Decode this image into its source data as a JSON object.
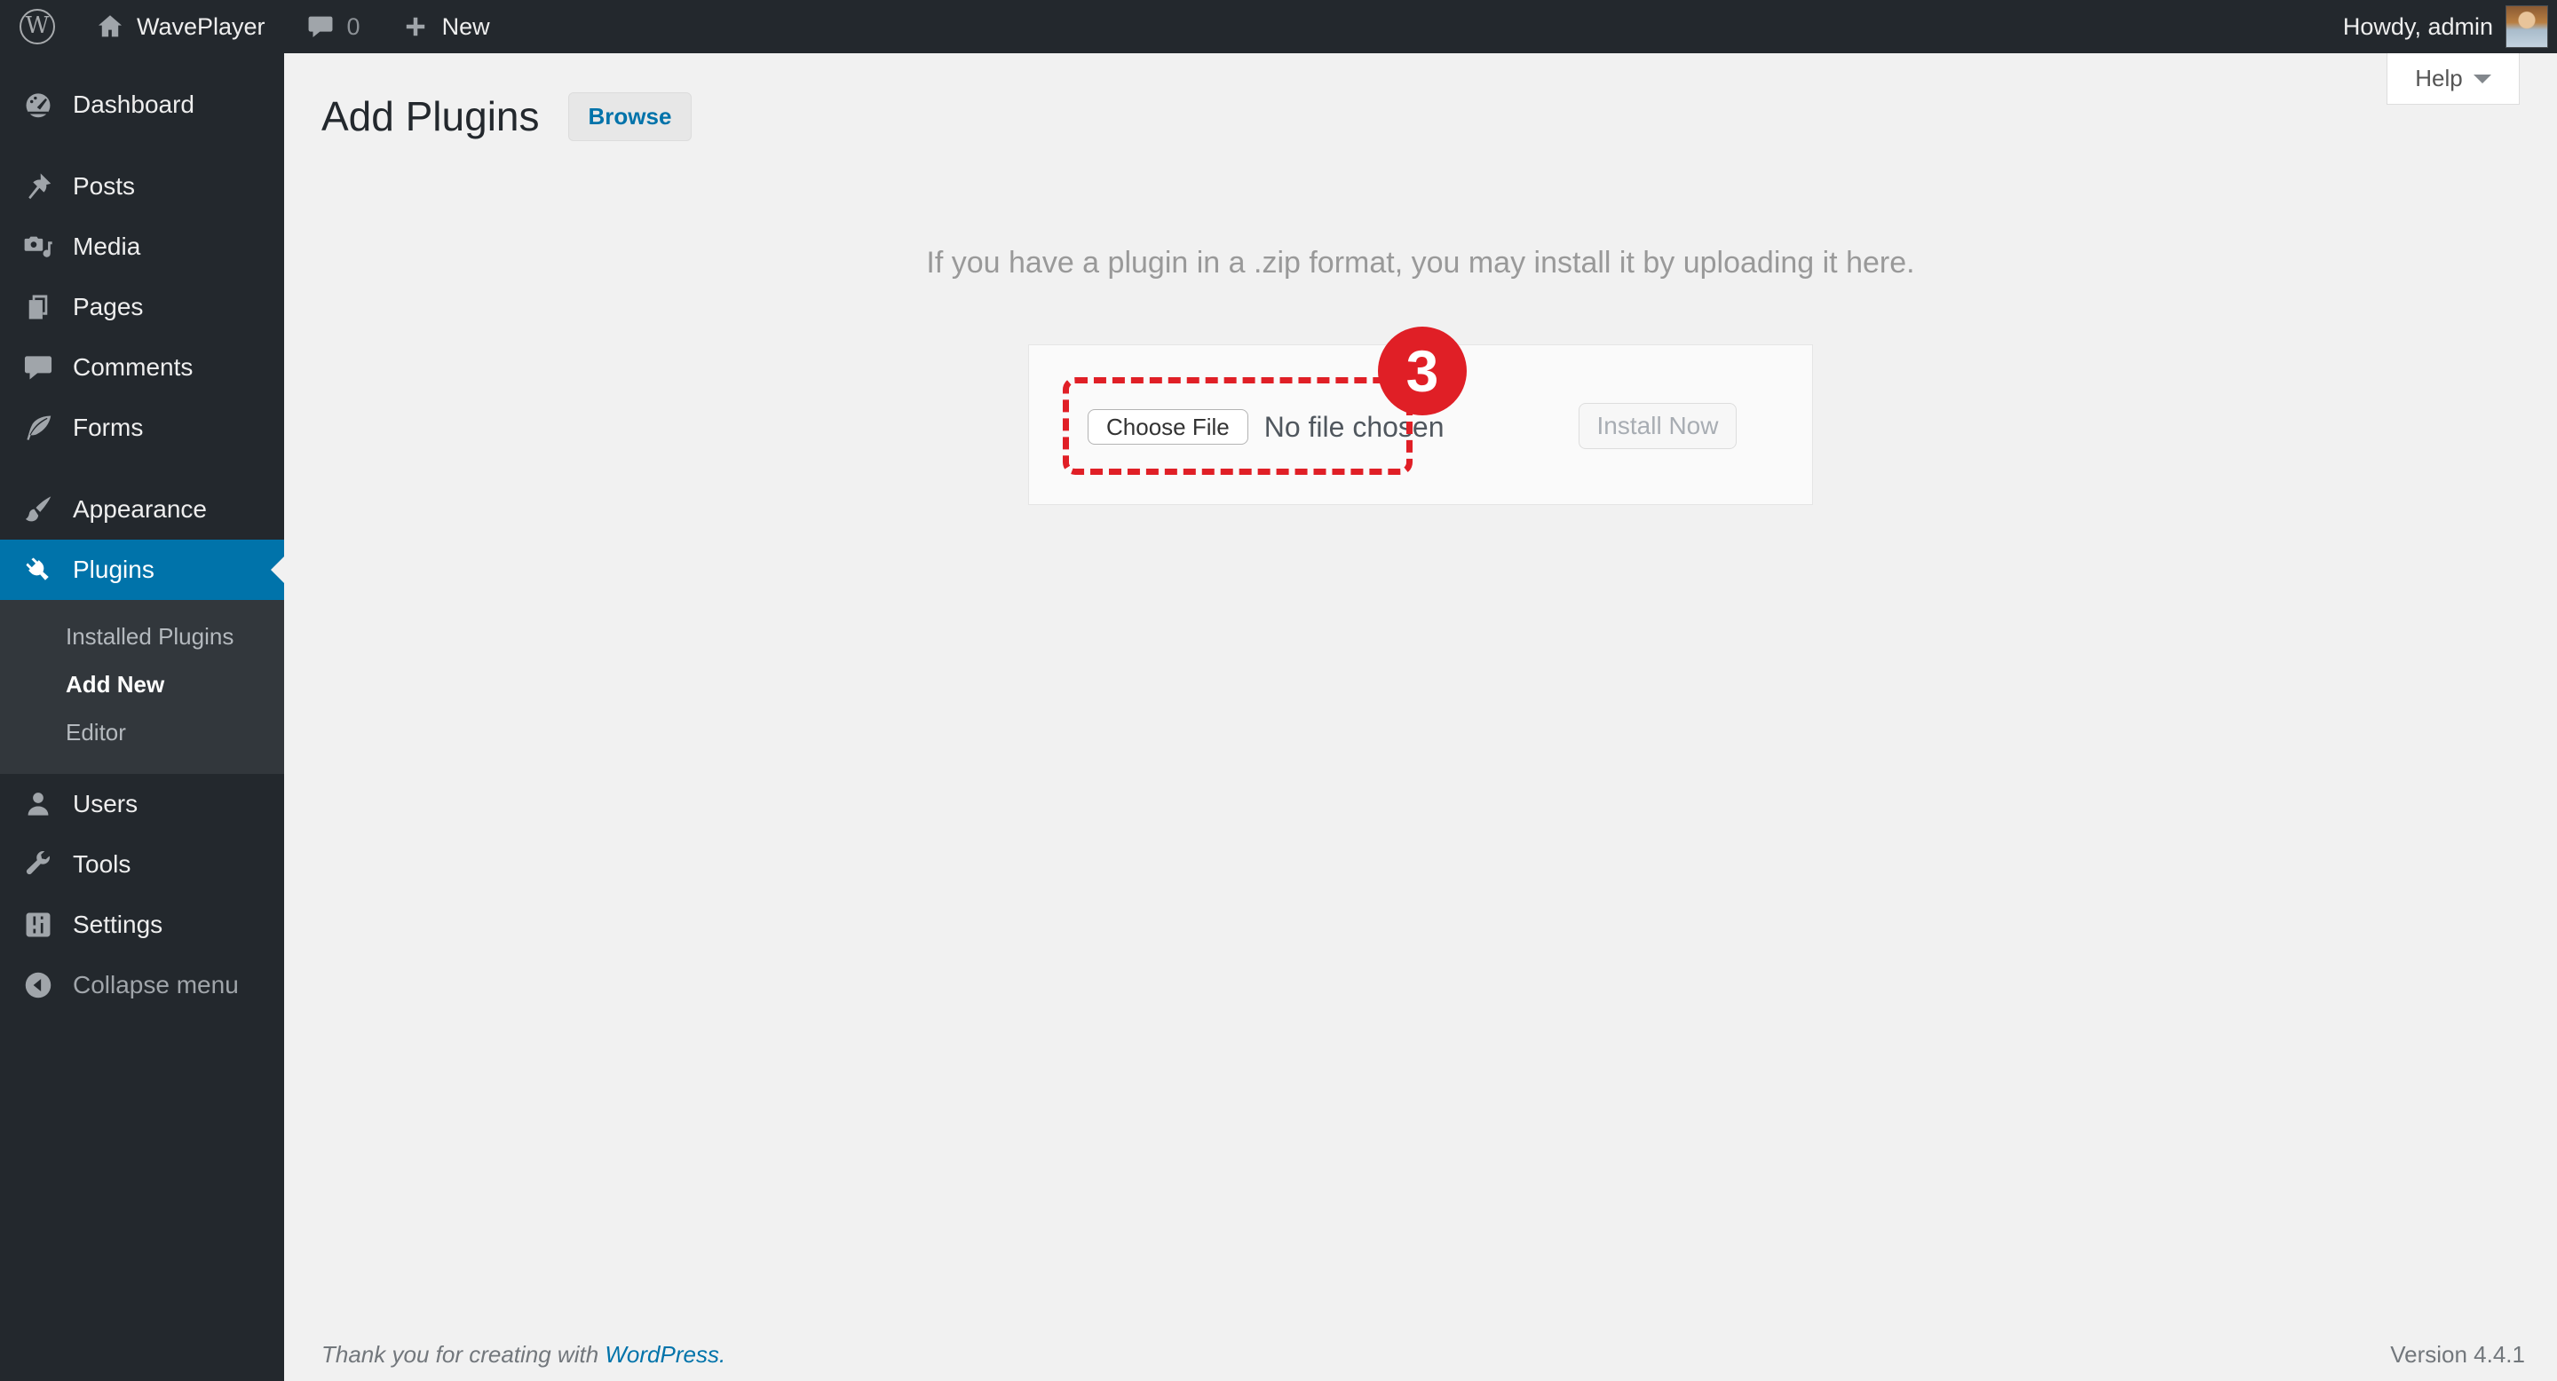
{
  "admin_bar": {
    "site_name": "WavePlayer",
    "comment_count": "0",
    "new_label": "New",
    "howdy": "Howdy, admin"
  },
  "sidebar": {
    "items": [
      {
        "label": "Dashboard",
        "icon": "dashboard-icon",
        "separator_before": false,
        "active": false
      },
      {
        "label": "Posts",
        "icon": "pushpin-icon",
        "separator_before": true,
        "active": false
      },
      {
        "label": "Media",
        "icon": "media-icon",
        "separator_before": false,
        "active": false
      },
      {
        "label": "Pages",
        "icon": "pages-icon",
        "separator_before": false,
        "active": false
      },
      {
        "label": "Comments",
        "icon": "comment-icon",
        "separator_before": false,
        "active": false
      },
      {
        "label": "Forms",
        "icon": "feather-icon",
        "separator_before": false,
        "active": false
      },
      {
        "label": "Appearance",
        "icon": "brush-icon",
        "separator_before": true,
        "active": false
      },
      {
        "label": "Plugins",
        "icon": "plugin-icon",
        "separator_before": false,
        "active": true,
        "submenu": [
          "Installed Plugins",
          "Add New",
          "Editor"
        ],
        "submenu_active": "Add New"
      },
      {
        "label": "Users",
        "icon": "user-icon",
        "separator_before": false,
        "active": false
      },
      {
        "label": "Tools",
        "icon": "wrench-icon",
        "separator_before": false,
        "active": false
      },
      {
        "label": "Settings",
        "icon": "settings-icon",
        "separator_before": false,
        "active": false
      },
      {
        "label": "Collapse menu",
        "icon": "collapse-icon",
        "separator_before": false,
        "active": false,
        "muted": true
      }
    ]
  },
  "main": {
    "help_label": "Help",
    "page_title": "Add Plugins",
    "browse_button": "Browse",
    "intro": "If you have a plugin in a .zip format, you may install it by uploading it here.",
    "upload": {
      "choose_file_label": "Choose File",
      "file_status": "No file chosen",
      "install_button": "Install Now",
      "annotation_step": "3"
    }
  },
  "footer": {
    "thanks_prefix": "Thank you for creating with ",
    "wordpress_link": "WordPress.",
    "version": "Version 4.4.1"
  },
  "colors": {
    "admin_dark": "#23282d",
    "submenu_dark": "#32373c",
    "accent_blue": "#0073aa",
    "content_bg": "#f1f1f1",
    "annotation_red": "#e01f26"
  }
}
